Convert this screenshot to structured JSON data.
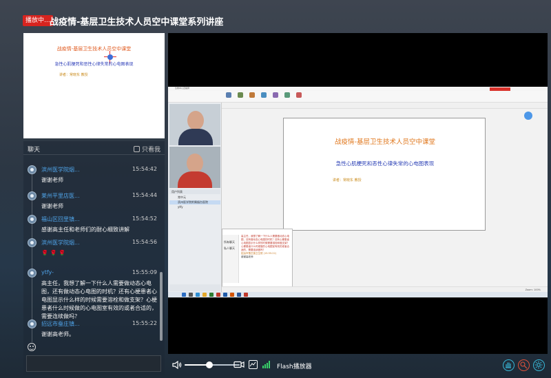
{
  "header": {
    "live_badge": "播放中...",
    "title": "战疫情-基层卫生技术人员空中课堂系列讲座"
  },
  "slide_thumbnail": {
    "title": "战疫情-基层卫生技术人员空中课堂",
    "subtitle": "急性心肌梗死和恶性心律失常的心电图表现",
    "speaker": "讲者：常晓东 教授"
  },
  "chat": {
    "title": "聊天",
    "only_me_label": "只看我",
    "input_placeholder": "",
    "messages": [
      {
        "user": "滨州医学院烟...",
        "time": "15:54:42",
        "text": "谢谢老师"
      },
      {
        "user": "莱州平里店医...",
        "time": "15:54:44",
        "text": "谢谢老师"
      },
      {
        "user": "福山区回里镇...",
        "time": "15:54:52",
        "text": "感谢高主任和老师们的耐心细致讲解"
      },
      {
        "user": "滨州医学院烟...",
        "time": "15:54:56",
        "text": "🌹 🌹 🌹"
      },
      {
        "user": "ytfy-",
        "time": "15:55:09",
        "text": "高主任，我想了解一下什么人需要做动态心电图，还有做动态心电图的时机？还有心梗患者心电图显示什么样的时候需要溶栓和做支架？心梗患者什么时候做的心电图室有效的或者合适的，需要连续做吗？"
      },
      {
        "user": "招远市蚕庄镇...",
        "time": "15:55:22",
        "text": "谢谢高老师。"
      }
    ]
  },
  "shared_screen": {
    "window_title": "急救中心直播屏",
    "slide_title": "战疫情-基层卫生技术人员空中课堂",
    "slide_subtitle": "急性心肌梗死和恶性心律失常的心电图表现",
    "slide_speaker": "讲者：常晓东 教授",
    "list_header": "用户列表",
    "list_items": [
      "常中元",
      "滨州医学院附属烟台医院",
      "ytfy"
    ],
    "chat_side": [
      "所有聊天",
      "私人聊天"
    ],
    "chat_snippet": "高主任，我想了解一下什么人需要做动态心电图，还有做动态心电图的时机？还有心梗患者心电图显示什么样的时候需要溶栓和做支架？心梗患者什么时候做的心电图室有效的或者合适的，需要连续做吗？",
    "chat_reply": "招远市蚕庄镇卫生院 (15:55:22)",
    "chat_reply_text": "谢谢高老师",
    "status_text": "Zoom: 100%"
  },
  "controls": {
    "flash_label": "Flash播放器",
    "volume_level": 0.45
  },
  "colors": {
    "live_badge": "#d7241f",
    "username": "#4fa3e8",
    "accent_cyan": "#38b8d8",
    "accent_red": "#e0523a"
  }
}
